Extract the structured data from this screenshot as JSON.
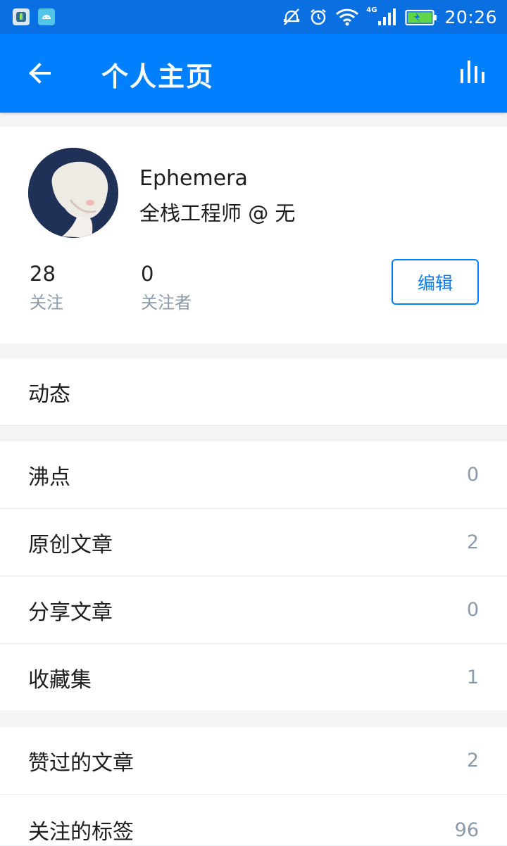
{
  "status_bar": {
    "time": "20:26",
    "network": "4G"
  },
  "header": {
    "title": "个人主页"
  },
  "profile": {
    "name": "Ephemera",
    "job": "全栈工程师 @ 无",
    "following": {
      "count": "28",
      "label": "关注"
    },
    "followers": {
      "count": "0",
      "label": "关注者"
    },
    "edit_label": "编辑"
  },
  "sections": {
    "activity": {
      "label": "动态"
    },
    "pins": {
      "label": "沸点",
      "count": "0"
    },
    "original_articles": {
      "label": "原创文章",
      "count": "2"
    },
    "shared_articles": {
      "label": "分享文章",
      "count": "0"
    },
    "collections": {
      "label": "收藏集",
      "count": "1"
    },
    "liked_articles": {
      "label": "赞过的文章",
      "count": "2"
    },
    "followed_tags": {
      "label": "关注的标签",
      "count": "96"
    }
  },
  "colors": {
    "brand": "#007fff",
    "status_bar": "#0a6fe0",
    "muted": "#8a9aa9"
  }
}
